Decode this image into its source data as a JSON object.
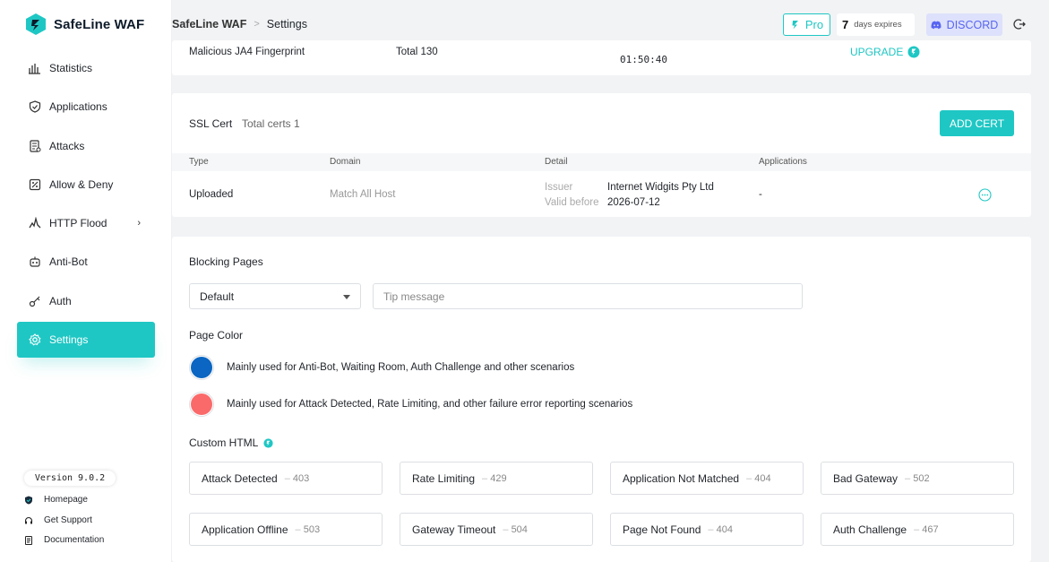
{
  "brand": {
    "name": "SafeLine WAF"
  },
  "sidebar": {
    "items": [
      {
        "label": "Statistics"
      },
      {
        "label": "Applications"
      },
      {
        "label": "Attacks"
      },
      {
        "label": "Allow & Deny"
      },
      {
        "label": "HTTP Flood",
        "has_submenu": true
      },
      {
        "label": "Anti-Bot"
      },
      {
        "label": "Auth"
      },
      {
        "label": "Settings",
        "active": true
      }
    ],
    "version": "Version 9.0.2",
    "links": [
      {
        "label": "Homepage"
      },
      {
        "label": "Get Support"
      },
      {
        "label": "Documentation"
      }
    ]
  },
  "header": {
    "breadcrumb": {
      "root": "SafeLine WAF",
      "current": "Settings"
    },
    "pro_label": "Pro",
    "expires": {
      "days": "7",
      "text": "days expires"
    },
    "discord_label": "DISCORD"
  },
  "fingerprint_card": {
    "name": "Malicious JA4 Fingerprint",
    "total": "Total 130",
    "time": "01:50:40",
    "upgrade_label": "UPGRADE"
  },
  "ssl": {
    "title": "SSL Cert",
    "count": "Total certs 1",
    "add_label": "ADD CERT",
    "columns": {
      "type": "Type",
      "domain": "Domain",
      "detail": "Detail",
      "applications": "Applications"
    },
    "row": {
      "type": "Uploaded",
      "domain": "Match All Host",
      "issuer_label": "Issuer",
      "issuer": "Internet Widgits Pty Ltd",
      "valid_label": "Valid before",
      "valid": "2026-07-12",
      "applications": "-"
    }
  },
  "blocking": {
    "title": "Blocking Pages",
    "select_value": "Default",
    "tip_placeholder": "Tip message",
    "page_color_title": "Page Color",
    "colors": [
      {
        "hex": "#0a66c2",
        "desc": "Mainly used for Anti-Bot, Waiting Room, Auth Challenge and other scenarios"
      },
      {
        "hex": "#fb6a6a",
        "desc": "Mainly used for Attack Detected, Rate Limiting, and other failure error reporting scenarios"
      }
    ],
    "custom_html_title": "Custom HTML",
    "pages": [
      {
        "name": "Attack Detected",
        "code": "403"
      },
      {
        "name": "Rate Limiting",
        "code": "429"
      },
      {
        "name": "Application Not Matched",
        "code": "404"
      },
      {
        "name": "Bad Gateway",
        "code": "502"
      },
      {
        "name": "Application Offline",
        "code": "503"
      },
      {
        "name": "Gateway Timeout",
        "code": "504"
      },
      {
        "name": "Page Not Found",
        "code": "404"
      },
      {
        "name": "Auth Challenge",
        "code": "467"
      }
    ]
  },
  "theme": {
    "accent": "#1fc7c4",
    "discord": "#5865f2"
  }
}
